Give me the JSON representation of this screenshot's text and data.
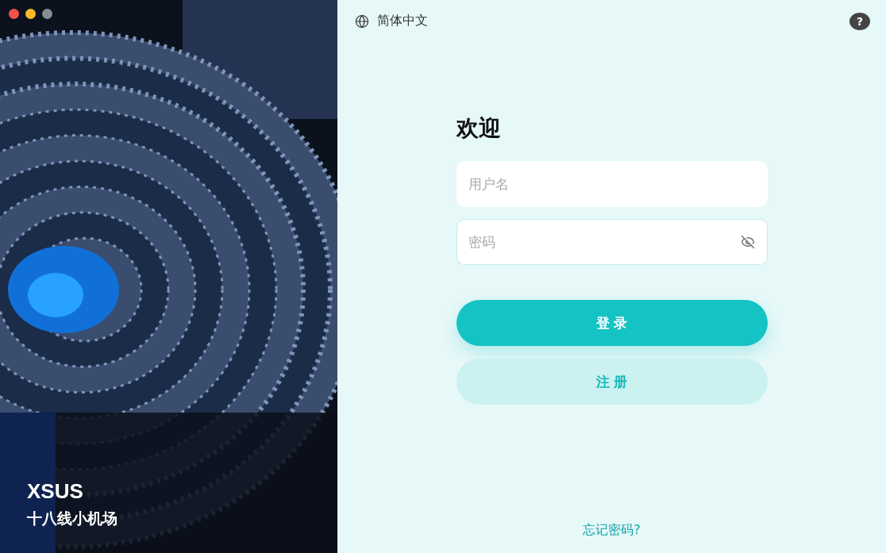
{
  "brand": {
    "name": "XSUS",
    "tagline": "十八线小机场"
  },
  "language": {
    "label": "简体中文"
  },
  "help": {
    "label": "?"
  },
  "form": {
    "title": "欢迎",
    "fields": [
      {
        "kind": "text",
        "placeholder": "用户名",
        "focused": false
      },
      {
        "kind": "password",
        "placeholder": "密码",
        "focused": true
      }
    ],
    "buttons": [
      {
        "kind": "primary",
        "label": "登 录"
      },
      {
        "kind": "secondary",
        "label": "注 册"
      }
    ]
  },
  "forgot_link": "忘记密码?"
}
